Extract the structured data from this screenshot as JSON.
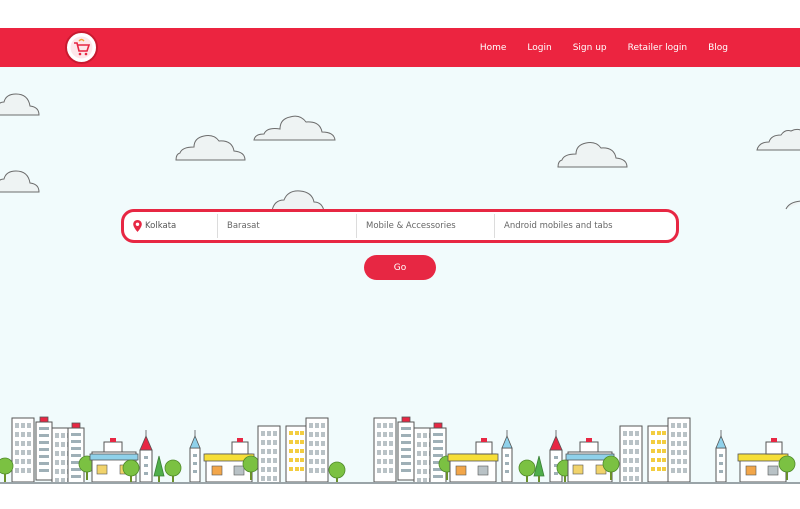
{
  "nav": {
    "links": [
      "Home",
      "Login",
      "Sign up",
      "Retailer login",
      "Blog"
    ]
  },
  "search": {
    "city_value": "Kolkata",
    "area_placeholder": "Barasat",
    "category_placeholder": "Mobile & Accessories",
    "subcategory_placeholder": "Android mobiles and tabs",
    "go_label": "Go"
  },
  "colors": {
    "brand_red": "#ec2440",
    "sky": "#f1fbfc",
    "cloud_stroke": "#6c6c6c"
  },
  "icons": {
    "logo": "shopping-cart-logo-icon",
    "location": "location-pin-icon"
  }
}
